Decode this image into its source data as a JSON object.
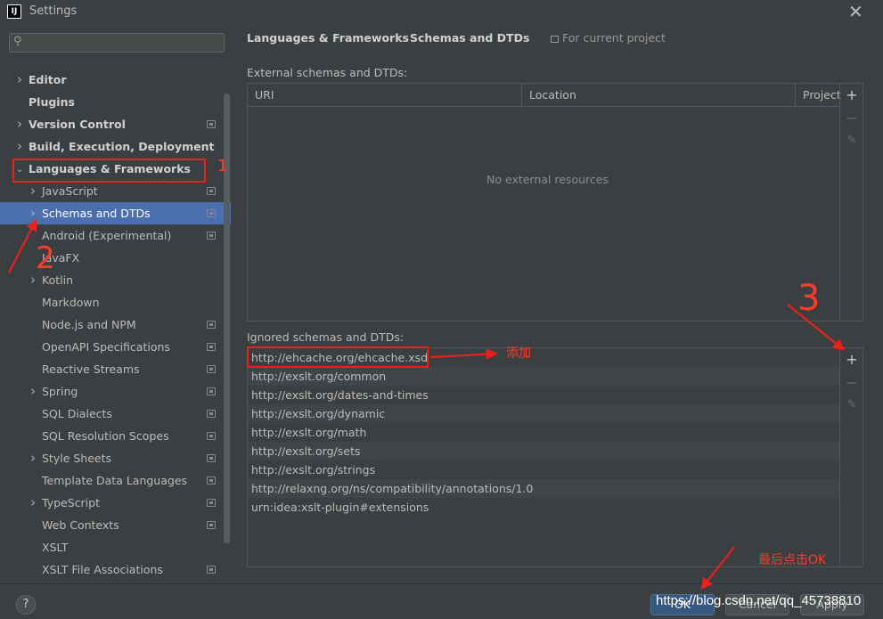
{
  "window": {
    "title": "Settings",
    "app_icon": "IJ"
  },
  "sidebar": {
    "search": {
      "value": "",
      "placeholder": ""
    },
    "items": [
      {
        "label": "Editor",
        "level": 0,
        "arrow": "right",
        "bold": true,
        "project": false
      },
      {
        "label": "Plugins",
        "level": 0,
        "arrow": "none",
        "bold": true,
        "project": false
      },
      {
        "label": "Version Control",
        "level": 0,
        "arrow": "right",
        "bold": true,
        "project": true
      },
      {
        "label": "Build, Execution, Deployment",
        "level": 0,
        "arrow": "right",
        "bold": true,
        "project": false
      },
      {
        "label": "Languages & Frameworks",
        "level": 0,
        "arrow": "down",
        "bold": true,
        "project": false
      },
      {
        "label": "JavaScript",
        "level": 1,
        "arrow": "right",
        "bold": false,
        "project": true
      },
      {
        "label": "Schemas and DTDs",
        "level": 1,
        "arrow": "right",
        "bold": false,
        "project": true,
        "selected": true
      },
      {
        "label": "Android (Experimental)",
        "level": 1,
        "arrow": "none",
        "bold": false,
        "project": true
      },
      {
        "label": "JavaFX",
        "level": 1,
        "arrow": "none",
        "bold": false,
        "project": false
      },
      {
        "label": "Kotlin",
        "level": 1,
        "arrow": "right",
        "bold": false,
        "project": false
      },
      {
        "label": "Markdown",
        "level": 1,
        "arrow": "none",
        "bold": false,
        "project": false
      },
      {
        "label": "Node.js and NPM",
        "level": 1,
        "arrow": "none",
        "bold": false,
        "project": true
      },
      {
        "label": "OpenAPI Specifications",
        "level": 1,
        "arrow": "none",
        "bold": false,
        "project": true
      },
      {
        "label": "Reactive Streams",
        "level": 1,
        "arrow": "none",
        "bold": false,
        "project": true
      },
      {
        "label": "Spring",
        "level": 1,
        "arrow": "right",
        "bold": false,
        "project": true
      },
      {
        "label": "SQL Dialects",
        "level": 1,
        "arrow": "none",
        "bold": false,
        "project": true
      },
      {
        "label": "SQL Resolution Scopes",
        "level": 1,
        "arrow": "none",
        "bold": false,
        "project": true
      },
      {
        "label": "Style Sheets",
        "level": 1,
        "arrow": "right",
        "bold": false,
        "project": true
      },
      {
        "label": "Template Data Languages",
        "level": 1,
        "arrow": "none",
        "bold": false,
        "project": true
      },
      {
        "label": "TypeScript",
        "level": 1,
        "arrow": "right",
        "bold": false,
        "project": true
      },
      {
        "label": "Web Contexts",
        "level": 1,
        "arrow": "none",
        "bold": false,
        "project": true
      },
      {
        "label": "XSLT",
        "level": 1,
        "arrow": "none",
        "bold": false,
        "project": false
      },
      {
        "label": "XSLT File Associations",
        "level": 1,
        "arrow": "none",
        "bold": false,
        "project": true
      }
    ]
  },
  "breadcrumb": {
    "parent": "Languages & Frameworks",
    "separator": "›",
    "current": "Schemas and DTDs",
    "scope": "For current project"
  },
  "external": {
    "label": "External schemas and DTDs:",
    "columns": [
      "URI",
      "Location",
      "Project"
    ],
    "empty_text": "No external resources"
  },
  "ignored": {
    "label": "Ignored schemas and DTDs:",
    "rows": [
      "http://ehcache.org/ehcache.xsd",
      "http://exslt.org/common",
      "http://exslt.org/dates-and-times",
      "http://exslt.org/dynamic",
      "http://exslt.org/math",
      "http://exslt.org/sets",
      "http://exslt.org/strings",
      "http://relaxng.org/ns/compatibility/annotations/1.0",
      "urn:idea:xslt-plugin#extensions"
    ]
  },
  "tools": {
    "add": "+",
    "remove": "−",
    "edit": "✎"
  },
  "footer": {
    "help": "?",
    "ok": "OK",
    "cancel": "Cancel",
    "apply": "Apply"
  },
  "annotations": {
    "n1": "1",
    "n2": "2",
    "n3": "3",
    "add_note": "添加",
    "ok_note": "最后点击OK",
    "watermark": "https://blog.csdn.net/qq_45738810",
    "color": "#e8211b"
  }
}
